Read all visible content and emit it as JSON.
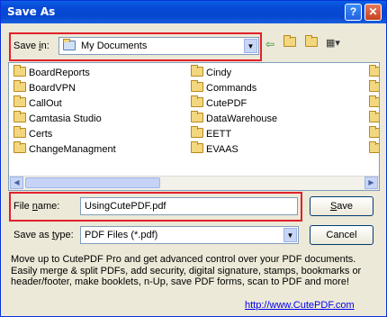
{
  "window": {
    "title": "Save As"
  },
  "titlebar": {
    "help_label": "?",
    "close_label": "✕"
  },
  "save_in": {
    "label_pre": "Save ",
    "label_key": "i",
    "label_post": "n:",
    "value": "My Documents"
  },
  "file_list": {
    "col1": [
      "BoardReports",
      "BoardVPN",
      "CallOut",
      "Camtasia Studio",
      "Certs",
      "ChangeManagment"
    ],
    "col2": [
      "Cindy",
      "Commands",
      "CutePDF",
      "DataWarehouse",
      "EETT",
      "EVAAS"
    ]
  },
  "file_name": {
    "label_pre": "File ",
    "label_key": "n",
    "label_post": "ame:",
    "value": "UsingCutePDF.pdf"
  },
  "save_type": {
    "label_pre": "Save as ",
    "label_key": "t",
    "label_post": "ype:",
    "value": "PDF Files (*.pdf)"
  },
  "buttons": {
    "save_key": "S",
    "save_rest": "ave",
    "cancel": "Cancel"
  },
  "promo": {
    "line1": "Move up to CutePDF Pro and get advanced control over your PDF documents.",
    "line2": "Easily merge & split PDFs, add security, digital signature, stamps, bookmarks or",
    "line3": "header/footer, make booklets, n-Up, save PDF forms, scan to PDF and more!",
    "link": "http://www.CutePDF.com"
  }
}
